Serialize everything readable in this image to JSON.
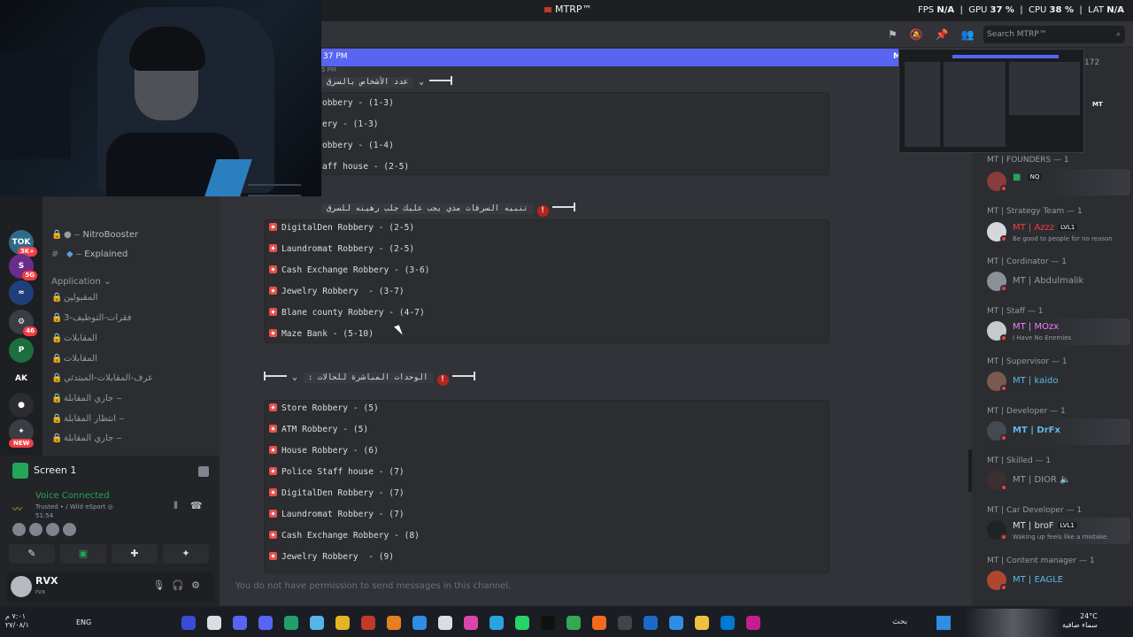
{
  "titlebar": {
    "app": "MTRP™",
    "perf": [
      {
        "label": "FPS",
        "value": "N/A"
      },
      {
        "label": "GPU",
        "value": "37 %"
      },
      {
        "label": "CPU",
        "value": "38 %"
      },
      {
        "label": "LAT",
        "value": "N/A"
      }
    ]
  },
  "header": {
    "search_placeholder": "Search MTRP™",
    "new_bar_time": "37 PM",
    "new_bar_right": "M",
    "tiny_time": "5 PM"
  },
  "servers": [
    {
      "label": "TOK",
      "badge": "3K+",
      "color": "#2d6a8a"
    },
    {
      "label": "S",
      "badge": "5G",
      "color": "#6b2d8a"
    },
    {
      "label": "≈",
      "badge": "",
      "color": "#1f3f7a"
    },
    {
      "label": "⚙",
      "badge": "46",
      "color": "#3a3d44"
    },
    {
      "label": "P",
      "badge": "",
      "color": "#1d6e3f"
    },
    {
      "label": "AK",
      "badge": "",
      "color": "#1e1f22"
    },
    {
      "label": "●",
      "badge": "",
      "color": "#2b2d31"
    },
    {
      "label": "✦",
      "badge": "",
      "color": "#3a3d44"
    }
  ],
  "new_badge": "NEW",
  "sidebar": {
    "channels_top": [
      {
        "name": "NitroBooster",
        "prefix": "‒",
        "emoji": "●"
      },
      {
        "name": "Explained",
        "prefix": "‒",
        "emoji": "◆"
      }
    ],
    "category": "Application",
    "channels_app": [
      "المقبولين",
      "فقرات-التوظيف-3",
      "المقابلات",
      "المقابلات",
      "غرف-المقابلات-المبتدئي",
      "جاري المقابلة ‒",
      "انتظار المقابلة ‒",
      "جاري المقابلة ‒"
    ]
  },
  "voice": {
    "screen_title": "Screen 1",
    "status": "Voice Connected",
    "channel": "Trusted • / Wild eSport ◎",
    "time": "51:54"
  },
  "user": {
    "name": "RVX",
    "status": "rvx"
  },
  "chat": {
    "heading1": "عدد الأشخاص بالسرق",
    "block1": [
      "obbery - (1-3)",
      "ery - (1-3)",
      "obbery - (1-4)",
      "aff house - (2-5)"
    ],
    "heading2": "تنبيه السرقات مذي يجب عليك جلب رهينه للسرق",
    "block2": [
      "DigitalDen Robbery - (2-5)",
      "Laundromat Robbery - (2-5)",
      "Cash Exchange Robbery - (3-6)",
      "Jewelry Robbery  - (3-7)",
      "Blane county Robbery - (4-7)",
      "Maze Bank - (5-10)"
    ],
    "heading3": "الوحدات المباشرة للحالات :",
    "block3": [
      "Store Robbery - (5)",
      "ATM Robbery - (5)",
      "House Robbery - (6)",
      "Police Staff house - (7)",
      "DigitalDen Robbery - (7)",
      "Laundromat Robbery - (7)",
      "Cash Exchange Robbery - (8)",
      "Jewelry Robbery  - (9)"
    ],
    "no_permission": "You do not have permission to send messages in this channel."
  },
  "members": {
    "count": "172",
    "thumb_tag": "MT",
    "groups": [
      {
        "role": "MT | FOUNDERS — 1",
        "name": "",
        "sub": "",
        "tag": "NQ",
        "color": "#dbdee1",
        "banner": true
      },
      {
        "role": "MT | Strategy Team — 1",
        "name": "MT | Azzz",
        "sub": "Be good to people for no reason",
        "tag": "LVL1",
        "color": "#f23f42",
        "banner": false
      },
      {
        "role": "MT | Cordinator — 1",
        "name": "MT | Abdulmalik",
        "sub": "",
        "tag": "",
        "color": "#949ba4",
        "banner": false
      },
      {
        "role": "MT | Staff — 1",
        "name": "MT | MOzx",
        "sub": "I Have No Enemies",
        "tag": "",
        "color": "#f47fff",
        "banner": true
      },
      {
        "role": "MT | Supervisor — 1",
        "name": "MT | kaido",
        "sub": "",
        "tag": "",
        "color": "#5fb8e6",
        "banner": false
      },
      {
        "role": "MT | Developer — 1",
        "name": "MT | DrFx",
        "sub": "",
        "tag": "",
        "color": "#5fb8e6",
        "banner": true
      },
      {
        "role": "MT | Skilled — 1",
        "name": "MT | DIOR",
        "sub": "",
        "tag": "",
        "color": "#949ba4",
        "banner": false
      },
      {
        "role": "MT | Car Developer — 1",
        "name": "MT | broF",
        "sub": "Waking up feels like a mistake.",
        "tag": "LVL1",
        "color": "#dbdee1",
        "banner": true
      },
      {
        "role": "MT | Content manager — 1",
        "name": "MT | EAGLE",
        "sub": "",
        "tag": "",
        "color": "#5fb8e6",
        "banner": false
      }
    ]
  },
  "taskbar": {
    "time": "٧:٠١ م",
    "date": "٢٧/٠٨/١",
    "lang": "ENG",
    "search": "بحث",
    "temp": "24°C",
    "weather": "سماء صافية",
    "app_colors": [
      "#3b4bd8",
      "#dbdee1",
      "#5865f2",
      "#5865f2",
      "#22a06b",
      "#56b4e9",
      "#e6b422",
      "#c0392b",
      "#e67e22",
      "#2f8de4",
      "#dbdee1",
      "#d946a8",
      "#2aa3e0",
      "#25d366",
      "#111111",
      "#34a853",
      "#f56a1f",
      "#444444",
      "#1b6ac9",
      "#2f8de4",
      "#f0c040",
      "#0078d4",
      "#c41f8e"
    ]
  }
}
